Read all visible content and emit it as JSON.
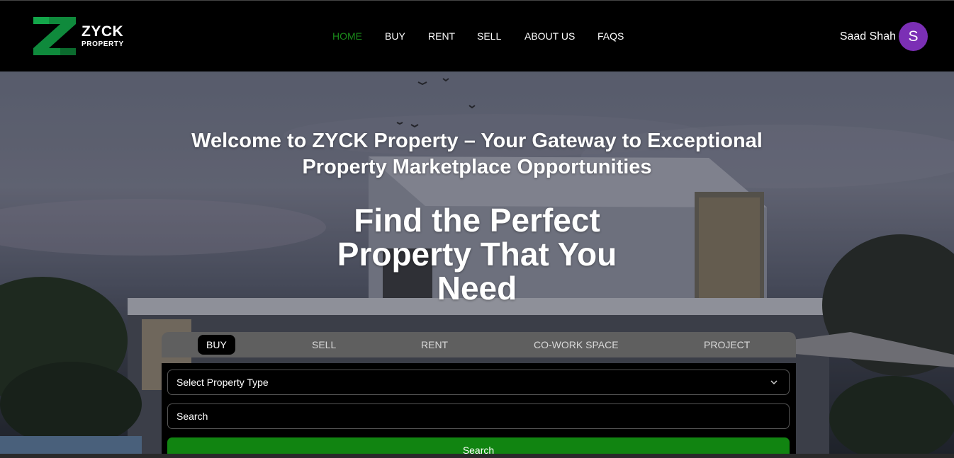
{
  "brand": {
    "name": "ZYCK",
    "subtitle": "PROPERTY",
    "colors": {
      "accent": "#118411",
      "logo_green": "#0f8a3c",
      "avatar": "#7b2fb5"
    }
  },
  "nav": {
    "items": [
      {
        "label": "HOME",
        "active": true
      },
      {
        "label": "BUY"
      },
      {
        "label": "RENT"
      },
      {
        "label": "SELL"
      },
      {
        "label": "ABOUT US"
      },
      {
        "label": "FAQS"
      }
    ]
  },
  "user": {
    "name": "Saad Shah",
    "initial": "S"
  },
  "hero": {
    "heading": "Welcome to ZYCK Property – Your Gateway to Exceptional Property Marketplace Opportunities",
    "title_line1": "Find the Perfect",
    "title_line2": "Property That You",
    "title_line3": "Need"
  },
  "search": {
    "tabs": [
      {
        "label": "BUY",
        "active": true
      },
      {
        "label": "SELL"
      },
      {
        "label": "RENT"
      },
      {
        "label": "CO-WORK SPACE"
      },
      {
        "label": "PROJECT"
      }
    ],
    "property_type_value": "Select Property Type",
    "search_placeholder": "Search",
    "button_label": "Search"
  }
}
